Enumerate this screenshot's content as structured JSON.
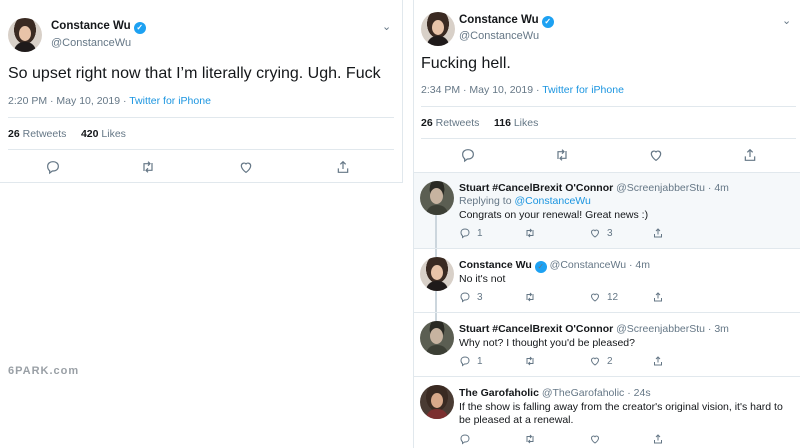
{
  "left_tweet": {
    "author_name": "Constance Wu",
    "author_handle": "@ConstanceWu",
    "text": "So upset right now that I’m literally crying. Ugh. Fuck",
    "time_date": "2:20 PM · May 10, 2019 · ",
    "source": "Twitter for iPhone",
    "retweets_count": "26",
    "retweets_label": " Retweets",
    "likes_count": "420",
    "likes_label": " Likes"
  },
  "right_tweet": {
    "author_name": "Constance Wu",
    "author_handle": "@ConstanceWu",
    "text": "Fucking hell.",
    "time_date": "2:34 PM · May 10, 2019 · ",
    "source": "Twitter for iPhone",
    "retweets_count": "26",
    "retweets_label": " Retweets",
    "likes_count": "116",
    "likes_label": " Likes"
  },
  "replies": [
    {
      "name": "Stuart #CancelBrexit O'Connor",
      "handle": "@ScreenjabberStu",
      "age": " · 4m",
      "replying_prefix": "Replying to ",
      "replying_to": "@ConstanceWu",
      "text": "Congrats on your renewal! Great news :)",
      "reply_count": "1",
      "retweet_count": "",
      "like_count": "3"
    },
    {
      "name": "Constance Wu",
      "handle": "@ConstanceWu",
      "age": " · 4m",
      "text": "No it's not",
      "reply_count": "3",
      "retweet_count": "",
      "like_count": "12"
    },
    {
      "name": "Stuart #CancelBrexit O'Connor",
      "handle": "@ScreenjabberStu",
      "age": " · 3m",
      "text": "Why not? I thought you'd be pleased?",
      "reply_count": "1",
      "retweet_count": "",
      "like_count": "2"
    },
    {
      "name": "The Garofaholic",
      "handle": "@TheGarofaholic",
      "age": " · 24s",
      "text": "If the show is falling away from the creator's original vision, it's hard to be pleased at a renewal."
    }
  ],
  "watermark": "6PARK.com",
  "colors": {
    "link": "#1b95e0",
    "verified": "#1da1f2",
    "muted": "#657786",
    "border": "#e1e8ed"
  },
  "icons": [
    "chevron-down-icon",
    "verified-icon",
    "reply-icon",
    "retweet-icon",
    "like-icon",
    "share-icon"
  ]
}
